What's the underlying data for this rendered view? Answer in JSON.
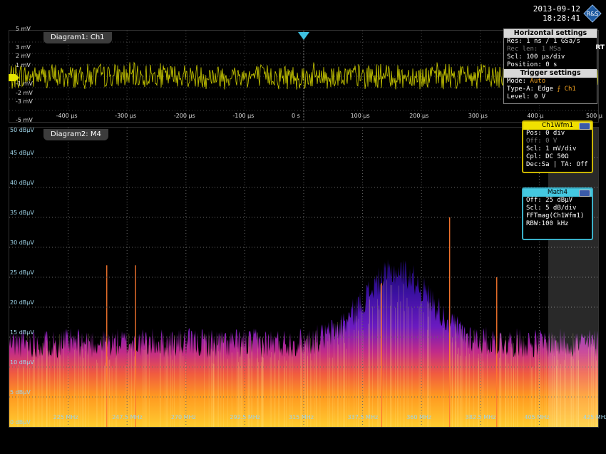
{
  "datetime": {
    "date": "2013-09-12",
    "time": "18:28:41"
  },
  "rt_badge": "RT",
  "diagram1": {
    "title": "Diagram1: Ch1",
    "y_ticks": [
      "5 mV",
      "3 mV",
      "2 mV",
      "1 mV",
      "",
      "-1 mV",
      "-2 mV",
      "-3 mV",
      "-5 mV"
    ],
    "x_ticks": [
      "-400 µs",
      "-300 µs",
      "-200 µs",
      "-100 µs",
      "0 s",
      "100 µs",
      "200 µs",
      "300 µs",
      "400 µ",
      "500 µ"
    ],
    "trace_color": "#e6e600"
  },
  "diagram2": {
    "title": "Diagram2: M4",
    "y_ticks": [
      "50 dBµV",
      "45 dBµV",
      "40 dBµV",
      "35 dBµV",
      "30 dBµV",
      "25 dBµV",
      "20 dBµV",
      "15 dBµV",
      "10 dBµV",
      "5 dBµV",
      "0 dBµV"
    ],
    "x_ticks": [
      "225 MHz",
      "247.5 MHz",
      "270 MHz",
      "292.5 MHz",
      "315 MHz",
      "337.5 MHz",
      "360 MHz",
      "382.5 MHz",
      "405 MHz",
      "425 MHz"
    ]
  },
  "horizontal": {
    "header": "Horizontal settings",
    "rows": [
      {
        "k": "Res:",
        "v": "1 ns / 1 GSa/s"
      },
      {
        "k": "Rec len:",
        "v": "1 MSa"
      },
      {
        "k": "Scl:",
        "v": "100 µs/div"
      },
      {
        "k": "Position:",
        "v": "0 s"
      }
    ]
  },
  "trigger": {
    "header": "Trigger settings",
    "mode_k": "Mode:",
    "mode_v": "Auto",
    "type_k": "Type-A:",
    "type_v": "Edge",
    "type_src": "Ch1",
    "level_k": "Level:",
    "level_v": "0 V"
  },
  "ch1wfm": {
    "header": "Ch1Wfm1",
    "rows": [
      "Pos: 0 div",
      "Off: 0 V",
      "Scl: 1 mV/div",
      "Cpl: DC 50Ω",
      "Dec:Sa | TA: Off"
    ]
  },
  "math4": {
    "header": "Math4",
    "rows": [
      "Off: 25 dBµV",
      "Scl: 5 dB/div",
      "FFTmag(Ch1Wfm1)",
      "RBW:100 kHz"
    ]
  },
  "chart_data": [
    {
      "type": "line",
      "title": "Diagram1: Ch1",
      "x_range": [
        -500,
        500
      ],
      "ylim": [
        -5,
        5
      ],
      "grid": true,
      "note_visible": "noise band roughly ±1.5 mV"
    },
    {
      "type": "area",
      "title": "Diagram2: M4",
      "x_range": [
        213.75,
        438.75
      ],
      "ylim": [
        0,
        50
      ],
      "grid": true,
      "peaks": [
        {
          "x": 251,
          "y": 27
        },
        {
          "x": 262,
          "y": 27
        },
        {
          "x": 356,
          "y": 24
        },
        {
          "x": 382,
          "y": 35
        },
        {
          "x": 400,
          "y": 25
        }
      ],
      "hump": {
        "center": 362,
        "peak": 26
      },
      "floor_level": 14
    }
  ]
}
